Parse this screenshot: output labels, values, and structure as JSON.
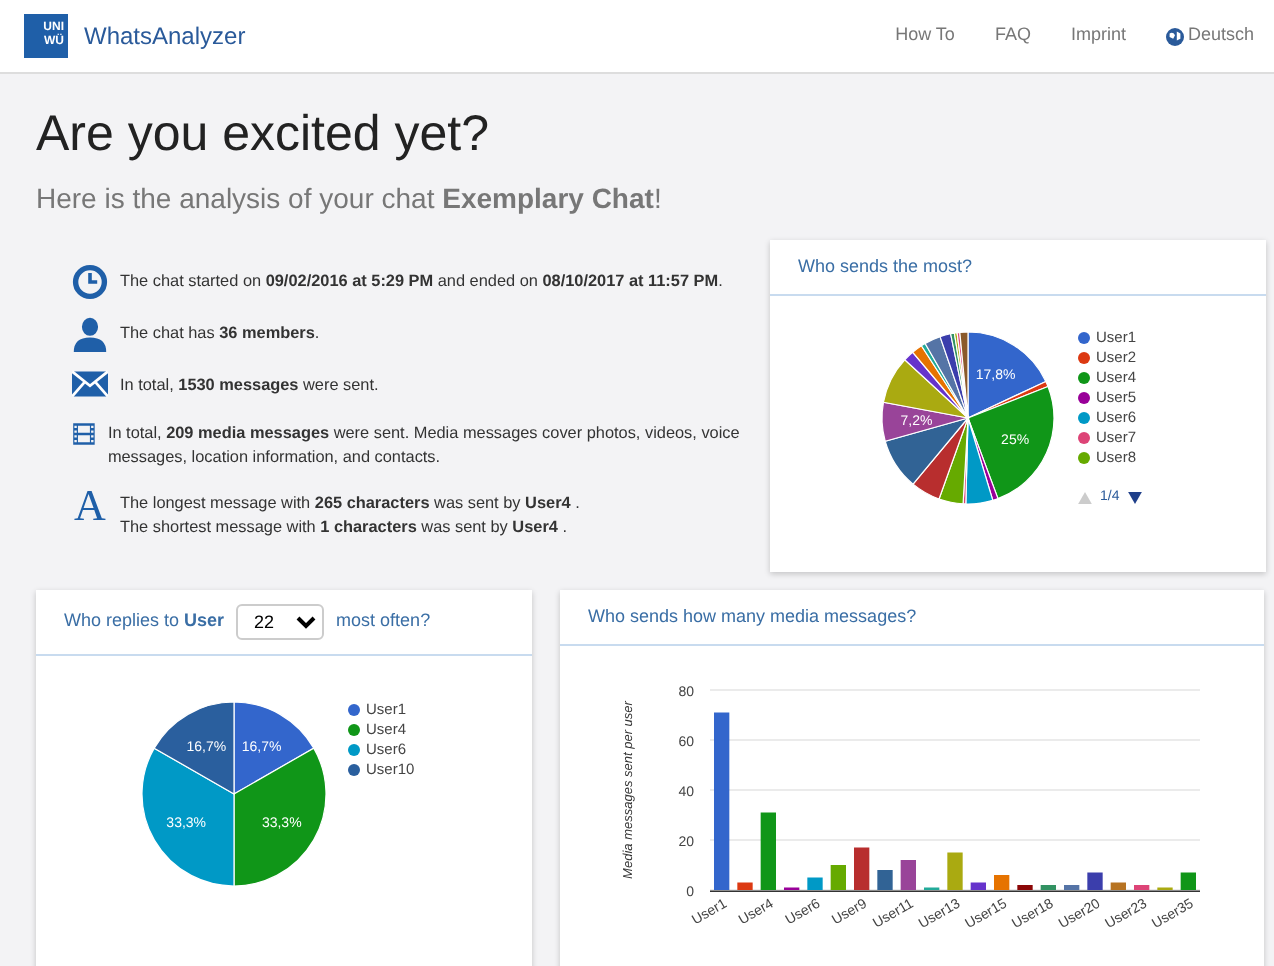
{
  "navbar": {
    "logo_text": [
      "UNI",
      "WÜ"
    ],
    "brand": "WhatsAnalyzer",
    "links": [
      {
        "label": "How To",
        "kind": "plain"
      },
      {
        "label": "FAQ",
        "kind": "plain"
      },
      {
        "label": "Imprint",
        "kind": "plain"
      },
      {
        "label": "Deutsch",
        "kind": "globe"
      }
    ]
  },
  "header": {
    "title": "Are you excited yet?",
    "subtitle": "Here is the analysis of your chat **Exemplary Chat**!"
  },
  "stats": [
    {
      "kind": "clock",
      "lines": [
        "The chat started on **09/02/2016 at 5:29 PM** and ended on **08/10/2017 at 11:57 PM**."
      ]
    },
    {
      "kind": "person",
      "lines": [
        "The chat has **36 members**."
      ]
    },
    {
      "kind": "envelope",
      "lines": [
        "In total, **1530 messages** were sent."
      ]
    },
    {
      "kind": "film",
      "lines": [
        "In total, **209 media messages** were sent. Media messages cover photos, videos, voice messages, location information, and contacts."
      ]
    },
    {
      "kind": "font",
      "glyph": "A",
      "lines": [
        "The longest message with **265 characters** was sent by **User4** .",
        "The shortest message with **1 characters** was sent by **User4** ."
      ]
    }
  ],
  "most_sent": {
    "title": "Who sends the most?",
    "slice_labels": [
      "17,8%",
      "25%",
      "7,2%"
    ],
    "legend": [
      {
        "name": "User1",
        "color": "#3366cc"
      },
      {
        "name": "User2",
        "color": "#dc3912"
      },
      {
        "name": "User4",
        "color": "#109618"
      },
      {
        "name": "User5",
        "color": "#990099"
      },
      {
        "name": "User6",
        "color": "#0099c6"
      },
      {
        "name": "User7",
        "color": "#dd4477"
      },
      {
        "name": "User8",
        "color": "#66aa00"
      }
    ],
    "pager": "1/4"
  },
  "replies": {
    "title_before": "Who replies to **User**",
    "select_value": "22",
    "title_after": "most often?",
    "chart_data": {
      "type": "pie",
      "categories": [
        "User1",
        "User4",
        "User6",
        "User10"
      ],
      "series": [
        {
          "values": [
            16.7,
            33.3,
            33.3,
            16.7
          ],
          "colors": [
            "#3366cc",
            "#109618",
            "#0099c6",
            "#2a5f9e"
          ]
        }
      ],
      "value_labels": [
        "16,7%",
        "33,3%",
        "33,3%",
        "16,7%"
      ]
    }
  },
  "media": {
    "title": "Who sends how many media messages?",
    "chart_data": {
      "type": "bar",
      "ylabel": "Media messages sent per user",
      "categories": [
        "User1",
        null,
        "User4",
        null,
        "User6",
        null,
        "User9",
        null,
        "User11",
        null,
        "User13",
        null,
        "User15",
        null,
        "User18",
        null,
        "User20",
        null,
        "User23",
        null,
        "User35"
      ],
      "ylim": [
        0,
        80
      ],
      "grid": true,
      "yticks": [
        0,
        20,
        40,
        60,
        80
      ],
      "series": [
        {
          "values": [
            71,
            3,
            31,
            1,
            5,
            10,
            17,
            8,
            12,
            1,
            15,
            3,
            6,
            2,
            2,
            2,
            7,
            3,
            2,
            1,
            7
          ],
          "colors": [
            "#3366cc",
            "#dc3912",
            "#109618",
            "#990099",
            "#0099c6",
            "#66aa00",
            "#b82e2e",
            "#316395",
            "#994499",
            "#22aa99",
            "#aaaa11",
            "#6633cc",
            "#e67300",
            "#8b0707",
            "#329262",
            "#5574a6",
            "#3b3eac",
            "#b77322",
            "#dd4477",
            "#aaaa11",
            "#109618"
          ]
        }
      ]
    }
  }
}
